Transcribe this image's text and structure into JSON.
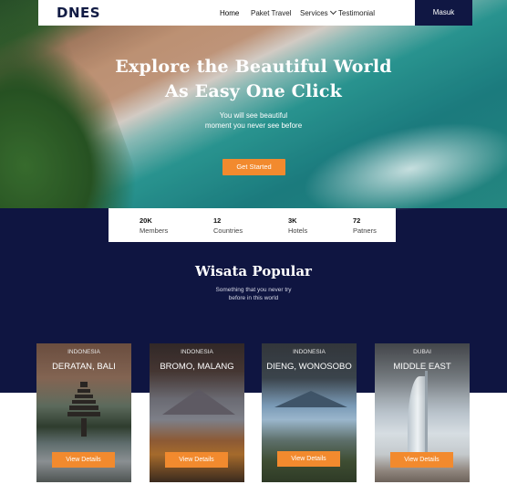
{
  "nav": {
    "logo": "DNES",
    "links": [
      "Home",
      "Paket Travel",
      "Services",
      "Testimonial"
    ],
    "login_label": "Masuk"
  },
  "hero": {
    "title_line1": "Explore the Beautiful World",
    "title_line2": "As Easy One Click",
    "subtitle_line1": "You will see beautiful",
    "subtitle_line2": "moment you never see before",
    "cta_label": "Get Started"
  },
  "stats": [
    {
      "value": "20K",
      "label": "Members"
    },
    {
      "value": "12",
      "label": "Countries"
    },
    {
      "value": "3K",
      "label": "Hotels"
    },
    {
      "value": "72",
      "label": "Patners"
    }
  ],
  "popular": {
    "title": "Wisata Popular",
    "subtitle_line1": "Something that you never try",
    "subtitle_line2": "before in this world"
  },
  "cards": [
    {
      "country": "Indonesia",
      "name": "DERATAN, BALI",
      "button": "View Details"
    },
    {
      "country": "Indonesia",
      "name": "BROMO, MALANG",
      "button": "View Details"
    },
    {
      "country": "Indonesia",
      "name": "DIENG, WONOSOBO",
      "button": "View Details"
    },
    {
      "country": "Dubai",
      "name": "MIDDLE EAST",
      "button": "View Details"
    }
  ],
  "colors": {
    "brand_navy": "#0f1541",
    "accent_orange": "#f28a2e"
  }
}
